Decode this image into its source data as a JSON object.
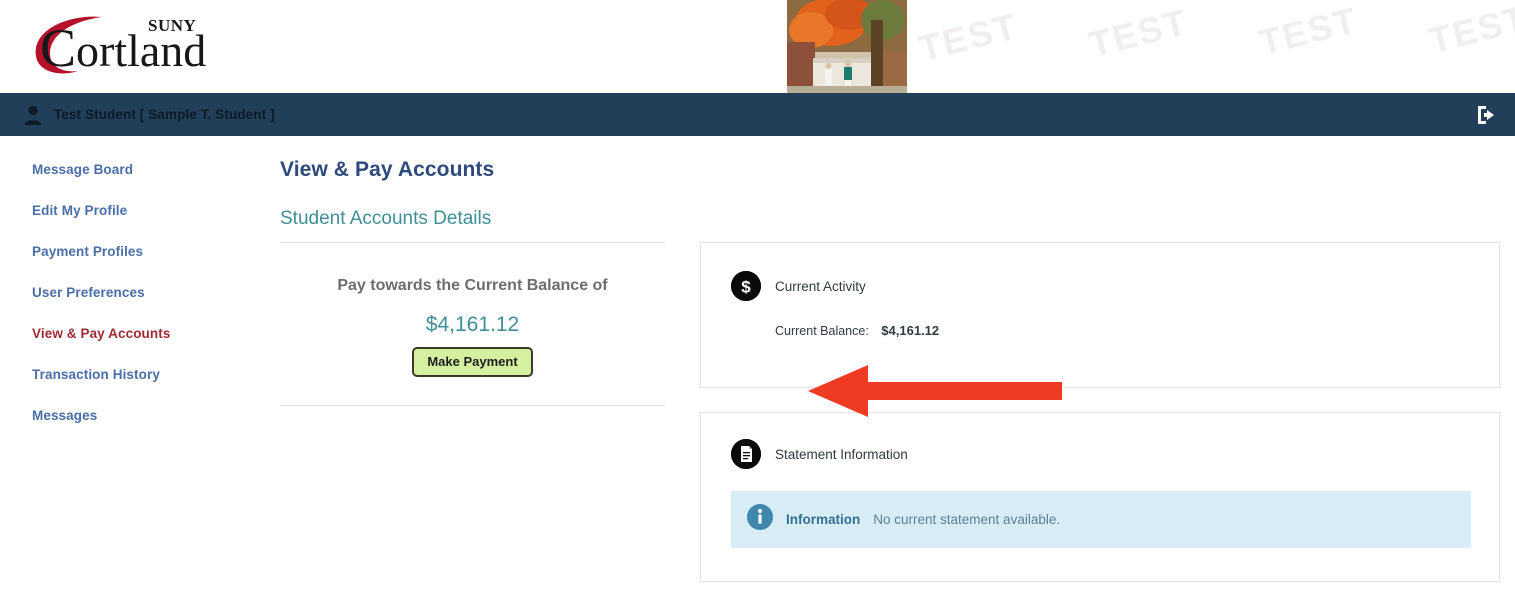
{
  "brand": {
    "logo_text": "Cortland",
    "logo_sup": "SUNY",
    "logo_color": "#b5112a",
    "banner_image_alt": "campus-autumn-photo",
    "watermarks": [
      "TEST",
      "TEST",
      "TEST",
      "TEST"
    ]
  },
  "userbar": {
    "user_icon": "user-icon",
    "user_label": "Test Student [ Sample T. Student ]",
    "logout_icon": "logout-icon",
    "background_color": "#223f5a"
  },
  "sidebar": {
    "items": [
      {
        "label": "Message Board",
        "active": false
      },
      {
        "label": "Edit My Profile",
        "active": false
      },
      {
        "label": "Payment Profiles",
        "active": false
      },
      {
        "label": "User Preferences",
        "active": false
      },
      {
        "label": "View & Pay Accounts",
        "active": true
      },
      {
        "label": "Transaction History",
        "active": false
      },
      {
        "label": "Messages",
        "active": false
      }
    ],
    "link_color": "#4a6ea8",
    "active_color": "#9e2b33"
  },
  "main": {
    "page_title": "View & Pay Accounts",
    "section_title": "Student Accounts Details",
    "pay_card": {
      "prompt": "Pay towards the Current Balance of",
      "amount": "$4,161.12",
      "button_label": "Make Payment",
      "button_color": "#d4f0a0"
    },
    "activity_panel": {
      "icon": "dollar-circle-icon",
      "title": "Current Activity",
      "balance_label": "Current Balance:",
      "balance_value": "$4,161.12"
    },
    "statement_panel": {
      "icon": "document-circle-icon",
      "title": "Statement Information",
      "alert": {
        "icon": "info-circle-icon",
        "strong": "Information",
        "text": "No current statement available.",
        "background_color": "#d9edf7"
      }
    }
  },
  "annotation": {
    "arrow": "left-pointing-arrow",
    "color": "#ef3b21"
  }
}
